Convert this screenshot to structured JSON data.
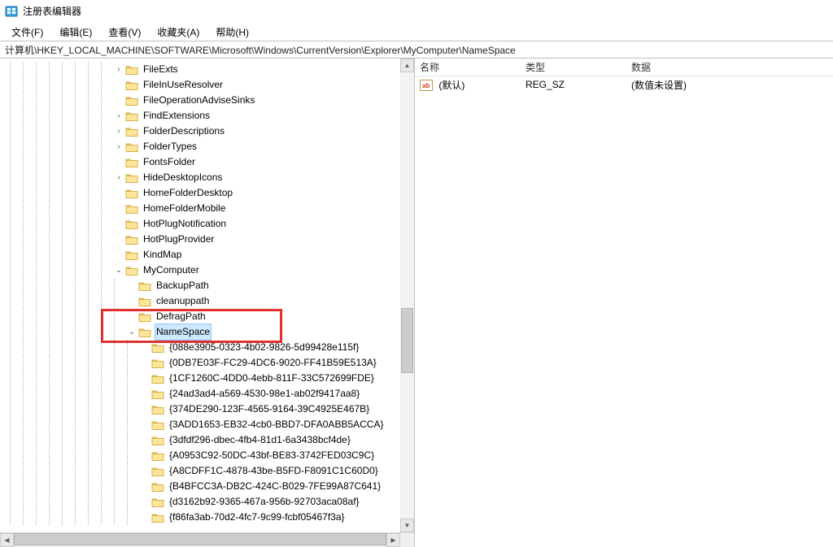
{
  "window": {
    "title": "注册表编辑器"
  },
  "menu": {
    "file": "文件(F)",
    "edit": "编辑(E)",
    "view": "查看(V)",
    "favorites": "收藏夹(A)",
    "help": "帮助(H)"
  },
  "address": "计算机\\HKEY_LOCAL_MACHINE\\SOFTWARE\\Microsoft\\Windows\\CurrentVersion\\Explorer\\MyComputer\\NameSpace",
  "tree": {
    "items": [
      {
        "label": "FileExts",
        "exp": "collapsed",
        "depth": 8
      },
      {
        "label": "FileInUseResolver",
        "exp": "none",
        "depth": 8
      },
      {
        "label": "FileOperationAdviseSinks",
        "exp": "none",
        "depth": 8
      },
      {
        "label": "FindExtensions",
        "exp": "collapsed",
        "depth": 8
      },
      {
        "label": "FolderDescriptions",
        "exp": "collapsed",
        "depth": 8
      },
      {
        "label": "FolderTypes",
        "exp": "collapsed",
        "depth": 8
      },
      {
        "label": "FontsFolder",
        "exp": "none",
        "depth": 8
      },
      {
        "label": "HideDesktopIcons",
        "exp": "collapsed",
        "depth": 8
      },
      {
        "label": "HomeFolderDesktop",
        "exp": "none",
        "depth": 8
      },
      {
        "label": "HomeFolderMobile",
        "exp": "none",
        "depth": 8
      },
      {
        "label": "HotPlugNotification",
        "exp": "none",
        "depth": 8
      },
      {
        "label": "HotPlugProvider",
        "exp": "none",
        "depth": 8
      },
      {
        "label": "KindMap",
        "exp": "none",
        "depth": 8
      },
      {
        "label": "MyComputer",
        "exp": "expanded",
        "depth": 8
      },
      {
        "label": "BackupPath",
        "exp": "none",
        "depth": 9
      },
      {
        "label": "cleanuppath",
        "exp": "none",
        "depth": 9
      },
      {
        "label": "DefragPath",
        "exp": "none",
        "depth": 9
      },
      {
        "label": "NameSpace",
        "exp": "expanded",
        "depth": 9,
        "selected": true
      },
      {
        "label": "{088e3905-0323-4b02-9826-5d99428e115f}",
        "exp": "none",
        "depth": 10
      },
      {
        "label": "{0DB7E03F-FC29-4DC6-9020-FF41B59E513A}",
        "exp": "none",
        "depth": 10
      },
      {
        "label": "{1CF1260C-4DD0-4ebb-811F-33C572699FDE}",
        "exp": "none",
        "depth": 10
      },
      {
        "label": "{24ad3ad4-a569-4530-98e1-ab02f9417aa8}",
        "exp": "none",
        "depth": 10
      },
      {
        "label": "{374DE290-123F-4565-9164-39C4925E467B}",
        "exp": "none",
        "depth": 10
      },
      {
        "label": "{3ADD1653-EB32-4cb0-BBD7-DFA0ABB5ACCA}",
        "exp": "none",
        "depth": 10
      },
      {
        "label": "{3dfdf296-dbec-4fb4-81d1-6a3438bcf4de}",
        "exp": "none",
        "depth": 10
      },
      {
        "label": "{A0953C92-50DC-43bf-BE83-3742FED03C9C}",
        "exp": "none",
        "depth": 10
      },
      {
        "label": "{A8CDFF1C-4878-43be-B5FD-F8091C1C60D0}",
        "exp": "none",
        "depth": 10
      },
      {
        "label": "{B4BFCC3A-DB2C-424C-B029-7FE99A87C641}",
        "exp": "none",
        "depth": 10
      },
      {
        "label": "{d3162b92-9365-467a-956b-92703aca08af}",
        "exp": "none",
        "depth": 10
      },
      {
        "label": "{f86fa3ab-70d2-4fc7-9c99-fcbf05467f3a}",
        "exp": "none",
        "depth": 10
      }
    ]
  },
  "list": {
    "headers": {
      "name": "名称",
      "type": "类型",
      "data": "数据"
    },
    "rows": [
      {
        "name": "(默认)",
        "type": "REG_SZ",
        "data": "(数值未设置)"
      }
    ]
  },
  "colors": {
    "highlight_border": "#e03030",
    "selection_bg": "#cde8ff"
  }
}
